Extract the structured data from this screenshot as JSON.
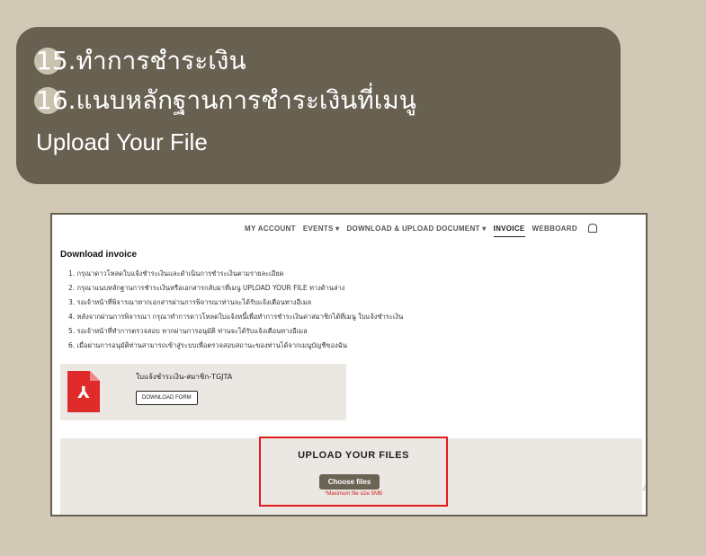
{
  "instructions": {
    "step15_num": "15.",
    "step15_text": " ทำการชำระเงิน",
    "step16_num": "16.",
    "step16_text": "แนบหลักฐานการชำระเงินที่เมนู",
    "step16_menu": "Upload Your File"
  },
  "nav": {
    "items": [
      "MY ACCOUNT",
      "EVENTS ▾",
      "DOWNLOAD & UPLOAD DOCUMENT ▾",
      "INVOICE",
      "WEBBOARD"
    ],
    "active": "INVOICE"
  },
  "page": {
    "title": "Download invoice",
    "steps": [
      "1. กรุณาดาวโหลดใบแจ้งชำระเงินและดำเนินการชำระเงินตามรายละเอียด",
      "2. กรุณาแนบหลักฐานการชำระเงินหรือเอกสารกลับมาที่เมนู UPLOAD YOUR FILE ทางด้านล่าง",
      "3. รอเจ้าหน้าที่พิจารณาหากเอกสารผ่านการพิจารณาท่านจะได้รับแจ้งเตือนทางอีเมล",
      "4. หลังจากผ่านการพิจารณา กรุณาทำการดาวโหลดใบแจ้งหนี้เพื่อทำการชำระเงินค่าสมาชิกได้ที่เมนู ใบแจ้งชำระเงิน",
      "5. รอเจ้าหน้าที่ทำการตรวจสอบ หากผ่านการอนุมัติ ท่านจะได้รับแจ้งเตือนทางอีเมล",
      "6. เมื่อผ่านการอนุมัติท่านสามารถเข้าสู่ระบบเพื่อตรวจสอบสถานะของท่านได้จากเมนูบัญชีของฉัน"
    ]
  },
  "download": {
    "file_name": "ใบแจ้งชำระเงิน-สมาชิก-TGJTA",
    "button": "DOWNLOAD FORM",
    "icon": "pdf-file-icon"
  },
  "upload": {
    "title": "UPLOAD YOUR FILES",
    "button": "Choose files",
    "note": "*Maximum file size 5MB",
    "edge": "A"
  },
  "colors": {
    "background": "#d1c9b5",
    "banner": "#686152",
    "accent_button": "#6b6354",
    "highlight": "#e21b1b",
    "pdf": "#e02b2b"
  }
}
